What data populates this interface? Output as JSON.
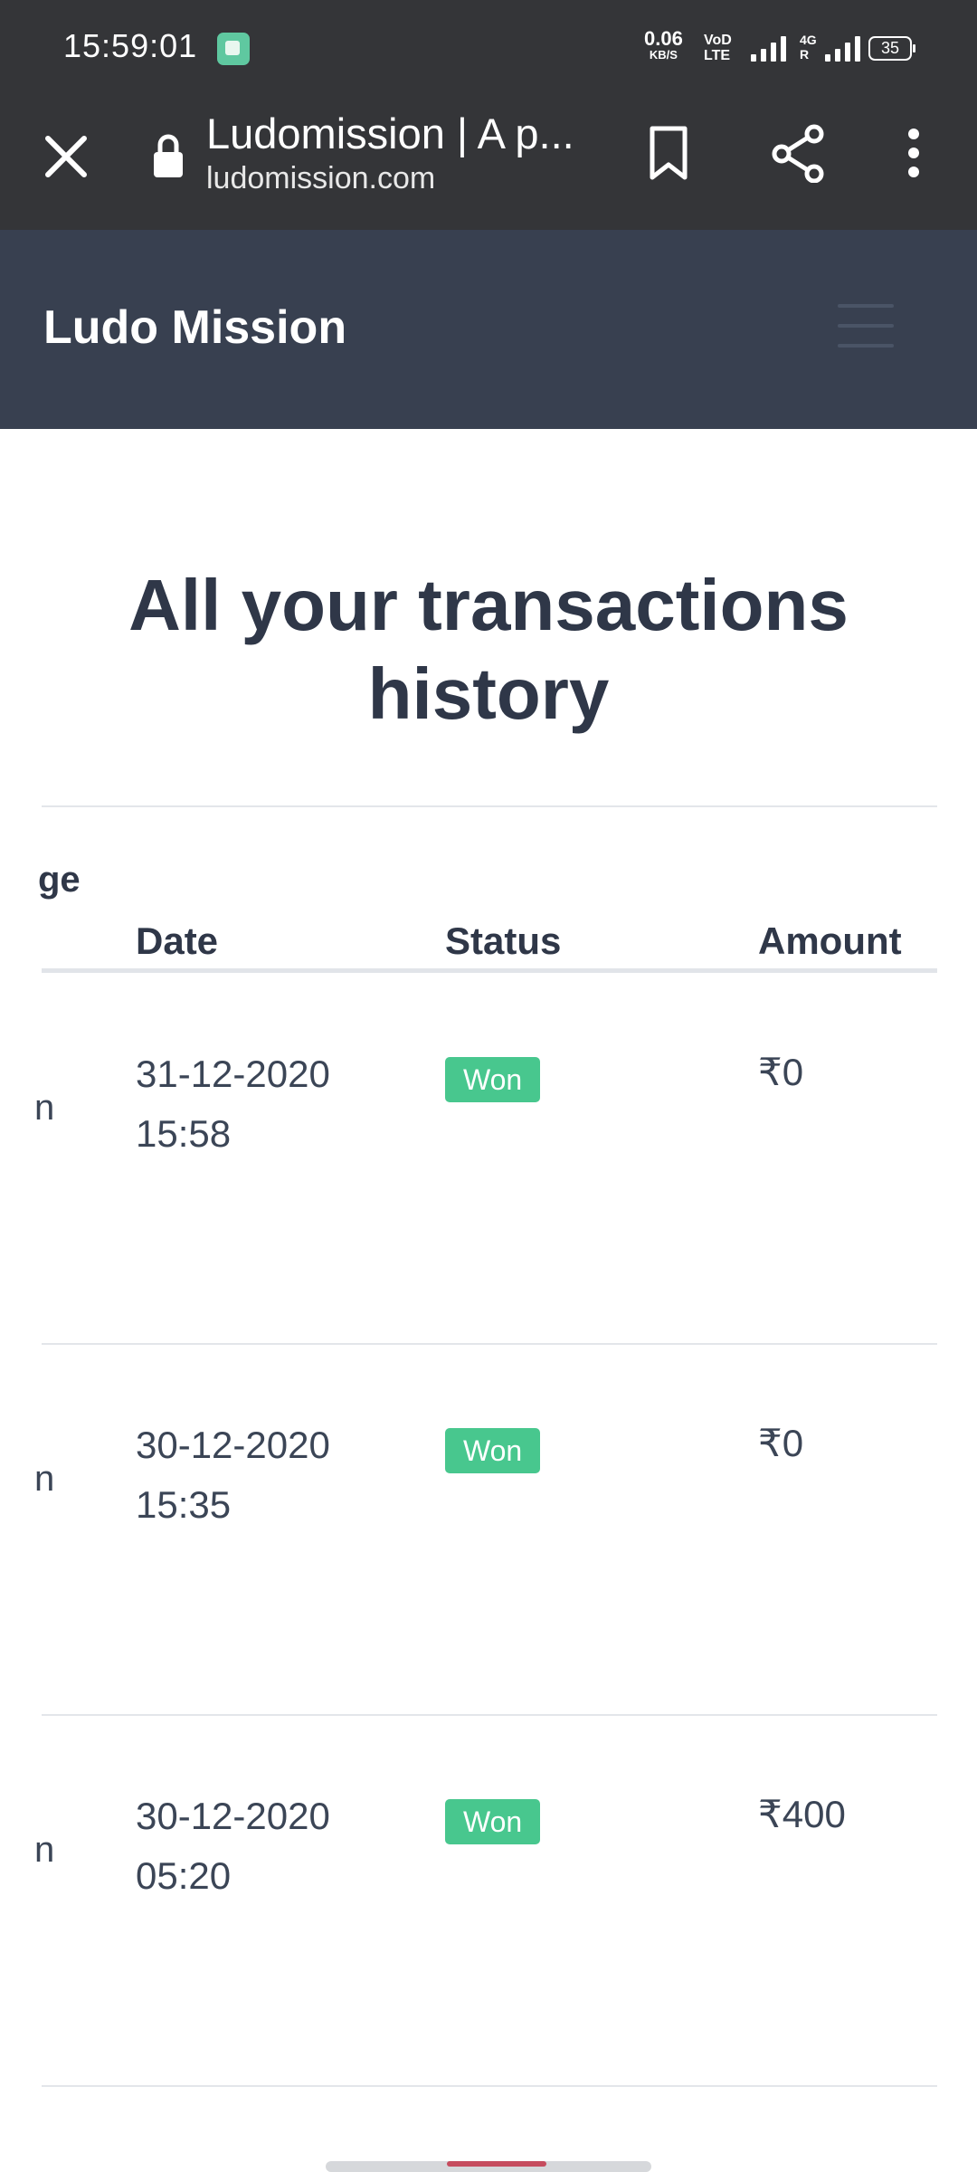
{
  "status_bar": {
    "time": "15:59:01",
    "net_speed": "0.06",
    "net_unit": "KB/S",
    "volte_top": "VoD",
    "volte_bottom": "LTE",
    "network_type": "4G",
    "network_sub": "R",
    "battery": "35"
  },
  "browser": {
    "page_title": "Ludomission | A p...",
    "url": "ludomission.com"
  },
  "site": {
    "logo": "Ludo Mission"
  },
  "page": {
    "heading": "All your transactions history"
  },
  "table": {
    "cut_header": "ge",
    "headers": {
      "date": "Date",
      "status": "Status",
      "amount": "Amount"
    },
    "rows": [
      {
        "cut": "n",
        "date": "31-12-2020",
        "time": "15:58",
        "status": "Won",
        "amount": "₹0"
      },
      {
        "cut": "n",
        "date": "30-12-2020",
        "time": "15:35",
        "status": "Won",
        "amount": "₹0"
      },
      {
        "cut": "n",
        "date": "30-12-2020",
        "time": "05:20",
        "status": "Won",
        "amount": "₹400"
      }
    ]
  },
  "colors": {
    "browser_chrome": "#343538",
    "site_header": "#384050",
    "won_badge": "#48c78e",
    "text_dark": "#2f3748"
  }
}
